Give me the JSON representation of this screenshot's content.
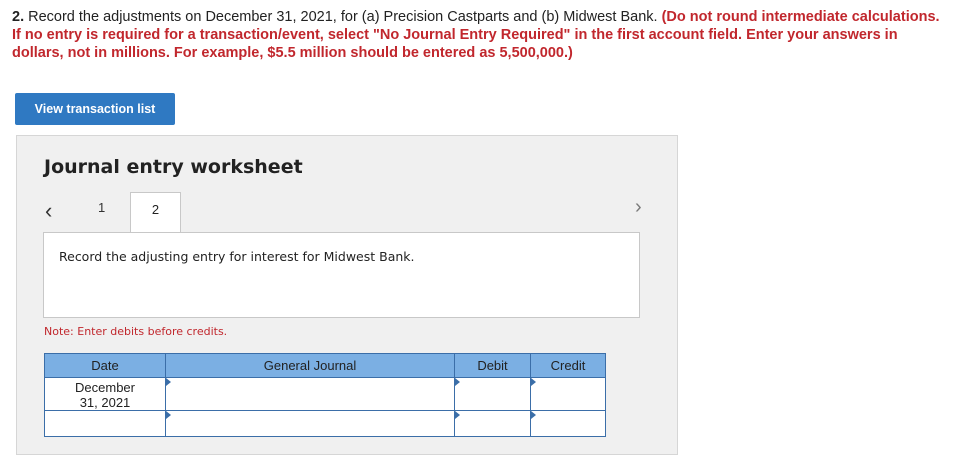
{
  "question": {
    "number": "2.",
    "text": " Record the adjustments on December 31, 2021, for (a) Precision Castparts and (b) Midwest Bank. ",
    "instructions": "(Do not round intermediate calculations. If no entry is required for a transaction/event, select \"No Journal Entry Required\" in the first account field. Enter your answers in dollars, not in millions. For example, $5.5 million should be entered as 5,500,000.)"
  },
  "buttons": {
    "view_transactions": "View transaction list"
  },
  "worksheet": {
    "title": "Journal entry worksheet",
    "tabs": [
      "1",
      "2"
    ],
    "active_tab": "2",
    "description": "Record the adjusting entry for interest for Midwest Bank.",
    "note": "Note: Enter debits before credits.",
    "table": {
      "headers": [
        "Date",
        "General Journal",
        "Debit",
        "Credit"
      ],
      "rows": [
        {
          "date": "December 31, 2021",
          "account": "",
          "debit": "",
          "credit": ""
        },
        {
          "date": "",
          "account": "",
          "debit": "",
          "credit": ""
        }
      ]
    }
  },
  "colors": {
    "button_blue": "#2f79c2",
    "header_blue": "#7bafe3",
    "instruction_red": "#c1272d"
  },
  "icons": {
    "prev": "chevron-left-icon",
    "next": "chevron-right-icon"
  }
}
